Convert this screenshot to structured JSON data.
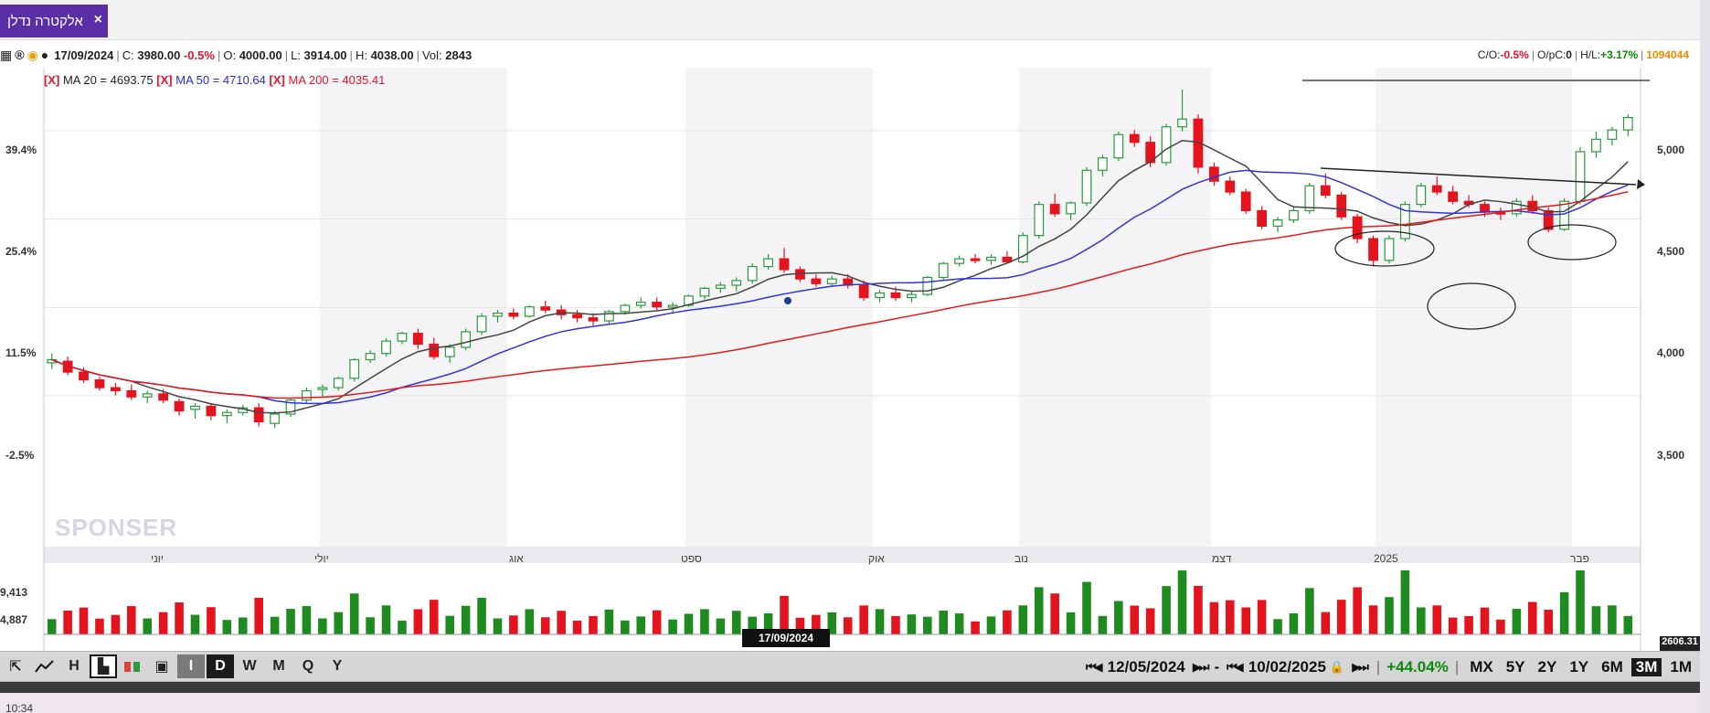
{
  "tab": {
    "title": "אלקטרה נדלן",
    "close": "×"
  },
  "info": {
    "date": "17/09/2024",
    "close_label": "C:",
    "close_value": "3980.00",
    "close_change": "-0.5%",
    "open_label": "O:",
    "open_value": "4000.00",
    "low_label": "L:",
    "low_value": "3914.00",
    "high_label": "H:",
    "high_value": "4038.00",
    "vol_label": "Vol:",
    "vol_value": "2843",
    "co_label": "C/O:",
    "co_value": "-0.5%",
    "opc_label": "O/pC:",
    "opc_value": "0",
    "hl_label": "H/L:",
    "hl_value": "+3.17%",
    "total_volume": "1094044"
  },
  "legend": {
    "x": "[X]",
    "ma20": "MA 20 = 4693.75",
    "ma50": "MA 50 = 4710.64",
    "ma200": "MA 200 = 4035.41"
  },
  "axes": {
    "pct_ticks": [
      "39.4%",
      "25.4%",
      "11.5%",
      "-2.5%"
    ],
    "price_ticks": [
      "5,000",
      "4,500",
      "4,000",
      "3,500"
    ],
    "volume_ticks": [
      "9,413",
      "4,887"
    ],
    "months": [
      "יוני",
      "יולי",
      "אוג",
      "ספט",
      "אוק",
      "נוב",
      "דצמ",
      "2025",
      "פבר"
    ]
  },
  "watermark": "SPONSER",
  "marker_date": "17/09/2024",
  "last_volume": "2606.31",
  "toolbar": {
    "chart_types": [
      "I",
      "D",
      "W",
      "M",
      "Q",
      "Y"
    ],
    "start_date": "12/05/2024",
    "dash": "-",
    "end_date": "10/02/2025",
    "change": "+44.04%",
    "periods": [
      "MX",
      "5Y",
      "2Y",
      "1Y",
      "6M",
      "3M",
      "1M"
    ],
    "active_period": "3M"
  },
  "taskbar": {
    "time": "10:34"
  },
  "chart_data": {
    "type": "candlestick",
    "date_range": [
      "12/05/2024",
      "10/02/2025"
    ],
    "price_axis": {
      "ticks": [
        5000,
        4500,
        4000,
        3500
      ],
      "range": [
        3000,
        5320
      ]
    },
    "ohlc_sampled": [
      [
        3560,
        3620,
        3520,
        3580
      ],
      [
        3570,
        3600,
        3480,
        3500
      ],
      [
        3500,
        3530,
        3430,
        3450
      ],
      [
        3450,
        3470,
        3380,
        3400
      ],
      [
        3400,
        3430,
        3350,
        3380
      ],
      [
        3380,
        3420,
        3320,
        3340
      ],
      [
        3340,
        3380,
        3300,
        3360
      ],
      [
        3360,
        3390,
        3300,
        3320
      ],
      [
        3310,
        3330,
        3220,
        3250
      ],
      [
        3260,
        3300,
        3200,
        3280
      ],
      [
        3280,
        3300,
        3190,
        3220
      ],
      [
        3220,
        3260,
        3170,
        3240
      ],
      [
        3240,
        3290,
        3220,
        3270
      ],
      [
        3270,
        3300,
        3150,
        3180
      ],
      [
        3170,
        3250,
        3140,
        3230
      ],
      [
        3230,
        3330,
        3210,
        3320
      ],
      [
        3320,
        3400,
        3300,
        3380
      ],
      [
        3390,
        3420,
        3340,
        3400
      ],
      [
        3400,
        3470,
        3380,
        3460
      ],
      [
        3460,
        3590,
        3440,
        3580
      ],
      [
        3580,
        3640,
        3560,
        3620
      ],
      [
        3620,
        3720,
        3600,
        3700
      ],
      [
        3700,
        3760,
        3680,
        3750
      ],
      [
        3750,
        3780,
        3650,
        3680
      ],
      [
        3680,
        3720,
        3580,
        3600
      ],
      [
        3600,
        3680,
        3560,
        3660
      ],
      [
        3660,
        3780,
        3640,
        3760
      ],
      [
        3760,
        3880,
        3740,
        3860
      ],
      [
        3860,
        3900,
        3820,
        3880
      ],
      [
        3880,
        3910,
        3840,
        3860
      ],
      [
        3860,
        3930,
        3850,
        3920
      ],
      [
        3920,
        3960,
        3880,
        3900
      ],
      [
        3900,
        3930,
        3840,
        3870
      ],
      [
        3870,
        3900,
        3820,
        3850
      ],
      [
        3850,
        3880,
        3800,
        3830
      ],
      [
        3830,
        3900,
        3810,
        3890
      ],
      [
        3890,
        3940,
        3870,
        3930
      ],
      [
        3930,
        3980,
        3910,
        3950
      ],
      [
        3950,
        3980,
        3900,
        3920
      ],
      [
        3920,
        3950,
        3880,
        3930
      ],
      [
        3930,
        4000,
        3920,
        3990
      ],
      [
        3990,
        4050,
        3970,
        4040
      ],
      [
        4040,
        4080,
        4010,
        4060
      ],
      [
        4060,
        4110,
        4020,
        4090
      ],
      [
        4090,
        4200,
        4070,
        4180
      ],
      [
        4180,
        4260,
        4160,
        4230
      ],
      [
        4230,
        4300,
        4140,
        4160
      ],
      [
        4160,
        4180,
        4080,
        4100
      ],
      [
        4100,
        4130,
        4050,
        4070
      ],
      [
        4070,
        4120,
        4050,
        4100
      ],
      [
        4100,
        4130,
        4040,
        4060
      ],
      [
        4060,
        4090,
        3960,
        3980
      ],
      [
        3980,
        4030,
        3950,
        4010
      ],
      [
        4010,
        4050,
        3960,
        3980
      ],
      [
        3980,
        4020,
        3950,
        4000
      ],
      [
        4000,
        4120,
        3990,
        4110
      ],
      [
        4110,
        4210,
        4090,
        4200
      ],
      [
        4200,
        4250,
        4180,
        4230
      ],
      [
        4230,
        4260,
        4200,
        4220
      ],
      [
        4220,
        4260,
        4190,
        4240
      ],
      [
        4240,
        4280,
        4200,
        4210
      ],
      [
        4210,
        4400,
        4200,
        4380
      ],
      [
        4380,
        4600,
        4360,
        4580
      ],
      [
        4580,
        4650,
        4500,
        4520
      ],
      [
        4520,
        4600,
        4480,
        4590
      ],
      [
        4590,
        4820,
        4570,
        4800
      ],
      [
        4800,
        4900,
        4760,
        4880
      ],
      [
        4880,
        5050,
        4860,
        5030
      ],
      [
        5030,
        5060,
        4950,
        4980
      ],
      [
        4980,
        5020,
        4820,
        4850
      ],
      [
        4850,
        5100,
        4830,
        5080
      ],
      [
        5080,
        5320,
        5050,
        5130
      ],
      [
        5130,
        5160,
        4780,
        4820
      ],
      [
        4820,
        4850,
        4700,
        4730
      ],
      [
        4730,
        4760,
        4640,
        4660
      ],
      [
        4660,
        4680,
        4520,
        4540
      ],
      [
        4540,
        4570,
        4420,
        4440
      ],
      [
        4440,
        4500,
        4400,
        4480
      ],
      [
        4480,
        4560,
        4460,
        4540
      ],
      [
        4540,
        4720,
        4520,
        4700
      ],
      [
        4700,
        4780,
        4620,
        4640
      ],
      [
        4640,
        4660,
        4480,
        4500
      ],
      [
        4500,
        4520,
        4330,
        4360
      ],
      [
        4360,
        4380,
        4180,
        4220
      ],
      [
        4220,
        4380,
        4200,
        4360
      ],
      [
        4360,
        4600,
        4340,
        4580
      ],
      [
        4580,
        4720,
        4560,
        4700
      ],
      [
        4700,
        4760,
        4640,
        4660
      ],
      [
        4660,
        4700,
        4580,
        4600
      ],
      [
        4600,
        4640,
        4560,
        4580
      ],
      [
        4580,
        4600,
        4500,
        4530
      ],
      [
        4530,
        4560,
        4480,
        4520
      ],
      [
        4520,
        4620,
        4500,
        4600
      ],
      [
        4600,
        4640,
        4520,
        4540
      ],
      [
        4540,
        4560,
        4400,
        4420
      ],
      [
        4420,
        4620,
        4410,
        4600
      ],
      [
        4600,
        4950,
        4580,
        4920
      ],
      [
        4920,
        5050,
        4880,
        5000
      ],
      [
        5000,
        5080,
        4960,
        5060
      ],
      [
        5060,
        5160,
        5020,
        5140
      ]
    ],
    "ma_last": {
      "ma20": 4693.75,
      "ma50": 4710.64,
      "ma200": 4035.41
    }
  }
}
